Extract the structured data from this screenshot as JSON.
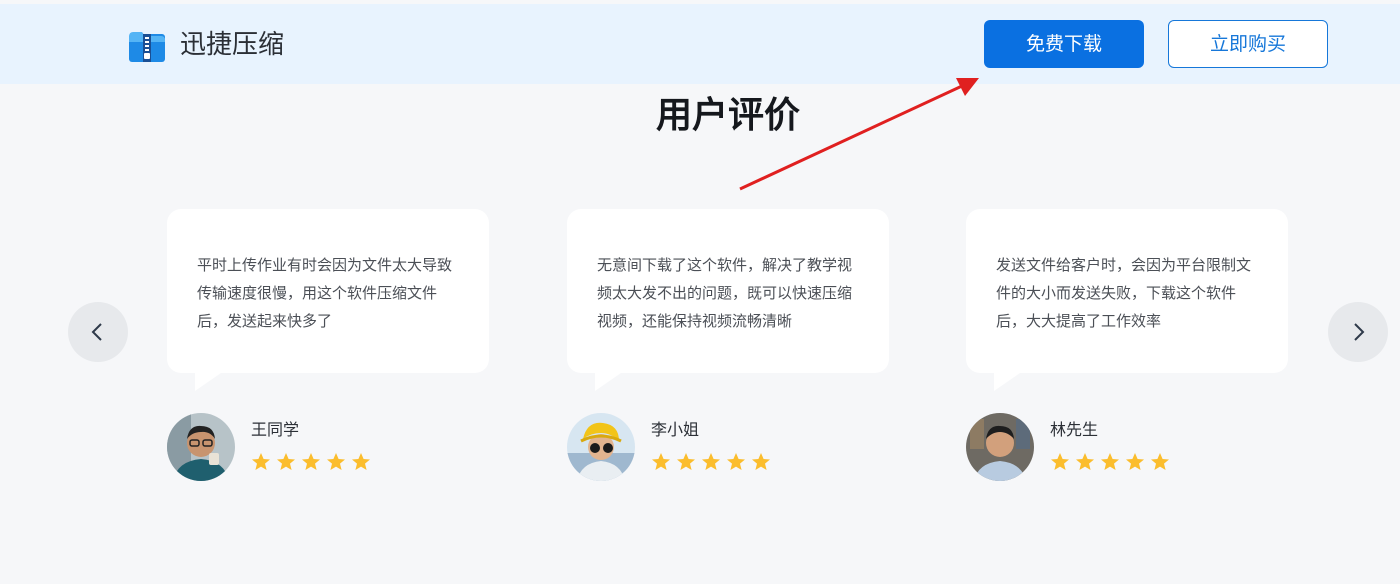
{
  "header": {
    "brand": "迅捷压缩",
    "download_label": "免费下载",
    "buy_label": "立即购买"
  },
  "section": {
    "title": "用户评价"
  },
  "reviews": [
    {
      "text": "平时上传作业有时会因为文件太大导致传输速度很慢，用这个软件压缩文件后，发送起来快多了",
      "name": "王同学",
      "rating": 5
    },
    {
      "text": "无意间下载了这个软件，解决了教学视频太大发不出的问题，既可以快速压缩视频，还能保持视频流畅清晰",
      "name": "李小姐",
      "rating": 5
    },
    {
      "text": "发送文件给客户时，会因为平台限制文件的大小而发送失败，下载这个软件后，大大提高了工作效率",
      "name": "林先生",
      "rating": 5
    }
  ],
  "icons": {
    "logo": "zip-folder-icon",
    "prev": "chevron-left-icon",
    "next": "chevron-right-icon",
    "star": "star-icon"
  },
  "colors": {
    "primary": "#0a70e1",
    "star": "#fbbd2d",
    "annotation_arrow": "#e02020",
    "header_bg": "#e8f3fe"
  }
}
